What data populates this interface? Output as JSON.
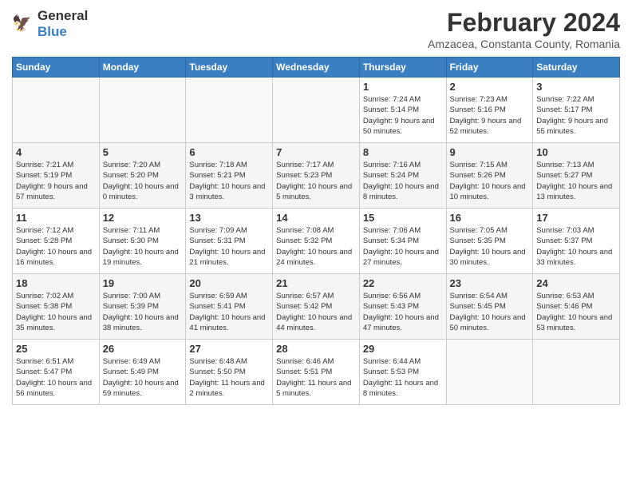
{
  "header": {
    "logo_line1": "General",
    "logo_line2": "Blue",
    "month": "February 2024",
    "location": "Amzacea, Constanta County, Romania"
  },
  "weekdays": [
    "Sunday",
    "Monday",
    "Tuesday",
    "Wednesday",
    "Thursday",
    "Friday",
    "Saturday"
  ],
  "rows": [
    [
      {
        "day": "",
        "empty": true
      },
      {
        "day": "",
        "empty": true
      },
      {
        "day": "",
        "empty": true
      },
      {
        "day": "",
        "empty": true
      },
      {
        "day": "1",
        "sunrise": "7:24 AM",
        "sunset": "5:14 PM",
        "daylight": "9 hours and 50 minutes."
      },
      {
        "day": "2",
        "sunrise": "7:23 AM",
        "sunset": "5:16 PM",
        "daylight": "9 hours and 52 minutes."
      },
      {
        "day": "3",
        "sunrise": "7:22 AM",
        "sunset": "5:17 PM",
        "daylight": "9 hours and 55 minutes."
      }
    ],
    [
      {
        "day": "4",
        "sunrise": "7:21 AM",
        "sunset": "5:19 PM",
        "daylight": "9 hours and 57 minutes."
      },
      {
        "day": "5",
        "sunrise": "7:20 AM",
        "sunset": "5:20 PM",
        "daylight": "10 hours and 0 minutes."
      },
      {
        "day": "6",
        "sunrise": "7:18 AM",
        "sunset": "5:21 PM",
        "daylight": "10 hours and 3 minutes."
      },
      {
        "day": "7",
        "sunrise": "7:17 AM",
        "sunset": "5:23 PM",
        "daylight": "10 hours and 5 minutes."
      },
      {
        "day": "8",
        "sunrise": "7:16 AM",
        "sunset": "5:24 PM",
        "daylight": "10 hours and 8 minutes."
      },
      {
        "day": "9",
        "sunrise": "7:15 AM",
        "sunset": "5:26 PM",
        "daylight": "10 hours and 10 minutes."
      },
      {
        "day": "10",
        "sunrise": "7:13 AM",
        "sunset": "5:27 PM",
        "daylight": "10 hours and 13 minutes."
      }
    ],
    [
      {
        "day": "11",
        "sunrise": "7:12 AM",
        "sunset": "5:28 PM",
        "daylight": "10 hours and 16 minutes."
      },
      {
        "day": "12",
        "sunrise": "7:11 AM",
        "sunset": "5:30 PM",
        "daylight": "10 hours and 19 minutes."
      },
      {
        "day": "13",
        "sunrise": "7:09 AM",
        "sunset": "5:31 PM",
        "daylight": "10 hours and 21 minutes."
      },
      {
        "day": "14",
        "sunrise": "7:08 AM",
        "sunset": "5:32 PM",
        "daylight": "10 hours and 24 minutes."
      },
      {
        "day": "15",
        "sunrise": "7:06 AM",
        "sunset": "5:34 PM",
        "daylight": "10 hours and 27 minutes."
      },
      {
        "day": "16",
        "sunrise": "7:05 AM",
        "sunset": "5:35 PM",
        "daylight": "10 hours and 30 minutes."
      },
      {
        "day": "17",
        "sunrise": "7:03 AM",
        "sunset": "5:37 PM",
        "daylight": "10 hours and 33 minutes."
      }
    ],
    [
      {
        "day": "18",
        "sunrise": "7:02 AM",
        "sunset": "5:38 PM",
        "daylight": "10 hours and 35 minutes."
      },
      {
        "day": "19",
        "sunrise": "7:00 AM",
        "sunset": "5:39 PM",
        "daylight": "10 hours and 38 minutes."
      },
      {
        "day": "20",
        "sunrise": "6:59 AM",
        "sunset": "5:41 PM",
        "daylight": "10 hours and 41 minutes."
      },
      {
        "day": "21",
        "sunrise": "6:57 AM",
        "sunset": "5:42 PM",
        "daylight": "10 hours and 44 minutes."
      },
      {
        "day": "22",
        "sunrise": "6:56 AM",
        "sunset": "5:43 PM",
        "daylight": "10 hours and 47 minutes."
      },
      {
        "day": "23",
        "sunrise": "6:54 AM",
        "sunset": "5:45 PM",
        "daylight": "10 hours and 50 minutes."
      },
      {
        "day": "24",
        "sunrise": "6:53 AM",
        "sunset": "5:46 PM",
        "daylight": "10 hours and 53 minutes."
      }
    ],
    [
      {
        "day": "25",
        "sunrise": "6:51 AM",
        "sunset": "5:47 PM",
        "daylight": "10 hours and 56 minutes."
      },
      {
        "day": "26",
        "sunrise": "6:49 AM",
        "sunset": "5:49 PM",
        "daylight": "10 hours and 59 minutes."
      },
      {
        "day": "27",
        "sunrise": "6:48 AM",
        "sunset": "5:50 PM",
        "daylight": "11 hours and 2 minutes."
      },
      {
        "day": "28",
        "sunrise": "6:46 AM",
        "sunset": "5:51 PM",
        "daylight": "11 hours and 5 minutes."
      },
      {
        "day": "29",
        "sunrise": "6:44 AM",
        "sunset": "5:53 PM",
        "daylight": "11 hours and 8 minutes."
      },
      {
        "day": "",
        "empty": true
      },
      {
        "day": "",
        "empty": true
      }
    ]
  ],
  "labels": {
    "sunrise": "Sunrise:",
    "sunset": "Sunset:",
    "daylight": "Daylight:"
  }
}
